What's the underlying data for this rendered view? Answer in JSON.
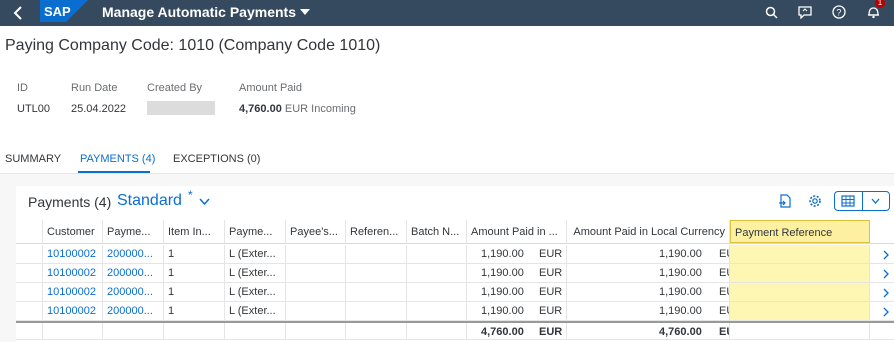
{
  "shell": {
    "app_title": "Manage Automatic Payments",
    "notification_count": "1",
    "colors": {
      "shell_bg": "#354a5f",
      "accent": "#0a6ed1"
    }
  },
  "header": {
    "title": "Paying Company Code: 1010 (Company Code 1010)",
    "id_label": "ID",
    "id_value": "UTL00",
    "run_date_label": "Run Date",
    "run_date_value": "25.04.2022",
    "created_by_label": "Created By",
    "amount_paid_label": "Amount Paid",
    "amount_paid_value": "4,760.00",
    "amount_paid_sub": "EUR Incoming"
  },
  "tabs": [
    {
      "label": "SUMMARY"
    },
    {
      "label": "PAYMENTS (4)"
    },
    {
      "label": "EXCEPTIONS (0)"
    }
  ],
  "table": {
    "title": "Payments (4)",
    "variant": "Standard",
    "variant_modified": "*",
    "columns": [
      "Customer",
      "Payme...",
      "Item In...",
      "Payme...",
      "Payee's...",
      "Referen...",
      "Batch N...",
      "Amount Paid in ...",
      "Amount Paid in Local Currency",
      "Payment Reference"
    ],
    "rows": [
      {
        "customer": "10100002",
        "payment": "200000...",
        "item": "1",
        "method": "L (Exter...",
        "amount": "1,190.00",
        "currency": "EUR",
        "local_amount": "1,190.00",
        "local_currency": "EUR"
      },
      {
        "customer": "10100002",
        "payment": "200000...",
        "item": "1",
        "method": "L (Exter...",
        "amount": "1,190.00",
        "currency": "EUR",
        "local_amount": "1,190.00",
        "local_currency": "EUR"
      },
      {
        "customer": "10100002",
        "payment": "200000...",
        "item": "1",
        "method": "L (Exter...",
        "amount": "1,190.00",
        "currency": "EUR",
        "local_amount": "1,190.00",
        "local_currency": "EUR"
      },
      {
        "customer": "10100002",
        "payment": "200000...",
        "item": "1",
        "method": "L (Exter...",
        "amount": "1,190.00",
        "currency": "EUR",
        "local_amount": "1,190.00",
        "local_currency": "EUR"
      }
    ],
    "totals": {
      "amount": "4,760.00",
      "currency": "EUR",
      "local_amount": "4,760.00",
      "local_currency": "EUR"
    }
  }
}
